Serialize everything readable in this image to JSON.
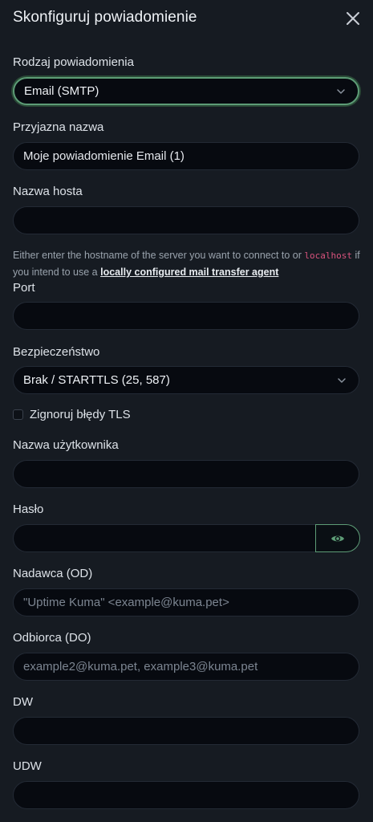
{
  "dialog": {
    "title": "Skonfiguruj powiadomienie",
    "close_icon": "close-icon"
  },
  "notification_type": {
    "label": "Rodzaj powiadomienia",
    "value": "Email (SMTP)"
  },
  "friendly_name": {
    "label": "Przyjazna nazwa",
    "value": "Moje powiadomienie Email (1)"
  },
  "hostname": {
    "label": "Nazwa hosta",
    "value": "",
    "hint_before": "Either enter the hostname of the server you want to connect to or ",
    "hint_code": "localhost",
    "hint_middle": " if you intend to use a ",
    "hint_link": "locally configured mail transfer agent"
  },
  "port": {
    "label": "Port",
    "value": ""
  },
  "security": {
    "label": "Bezpieczeństwo",
    "value": "Brak / STARTTLS (25, 587)"
  },
  "ignore_tls": {
    "label": "Zignoruj błędy TLS",
    "checked": false
  },
  "username": {
    "label": "Nazwa użytkownika",
    "value": ""
  },
  "password": {
    "label": "Hasło",
    "value": "",
    "toggle_icon": "eye-icon"
  },
  "from": {
    "label": "Nadawca (OD)",
    "placeholder": "\"Uptime Kuma\" <example@kuma.pet>"
  },
  "to": {
    "label": "Odbiorca (DO)",
    "placeholder": "example2@kuma.pet, example3@kuma.pet"
  },
  "cc": {
    "label": "DW",
    "value": ""
  },
  "bcc": {
    "label": "UDW",
    "value": ""
  },
  "colors": {
    "background": "#161b22",
    "input_background": "#070a10",
    "accent": "#5d9c76",
    "code": "#d9537d"
  }
}
